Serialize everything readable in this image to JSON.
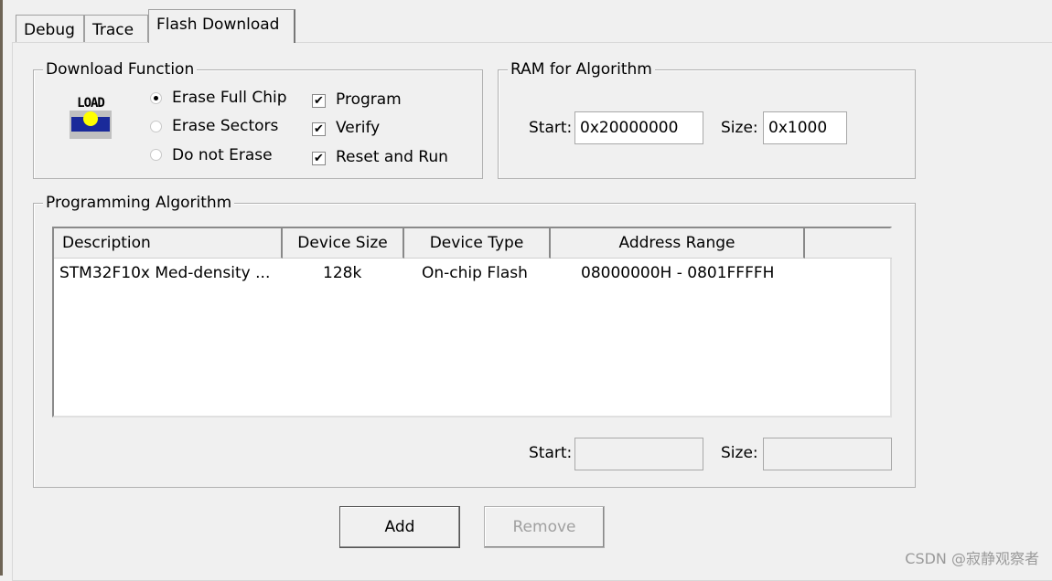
{
  "tabs": [
    {
      "label": "Debug"
    },
    {
      "label": "Trace"
    },
    {
      "label": "Flash Download",
      "active": true
    }
  ],
  "download_function": {
    "title": "Download Function",
    "icon": "load-icon",
    "icon_text": "LOAD",
    "radios": [
      {
        "label": "Erase Full Chip",
        "checked": true
      },
      {
        "label": "Erase Sectors",
        "checked": false
      },
      {
        "label": "Do not Erase",
        "checked": false
      }
    ],
    "checkboxes": [
      {
        "label": "Program",
        "checked": true
      },
      {
        "label": "Verify",
        "checked": true
      },
      {
        "label": "Reset and Run",
        "checked": true
      }
    ],
    "check_glyph": "✔"
  },
  "ram": {
    "title": "RAM for Algorithm",
    "start_label": "Start:",
    "start_value": "0x20000000",
    "size_label": "Size:",
    "size_value": "0x1000"
  },
  "algorithm": {
    "title": "Programming Algorithm",
    "columns": [
      "Description",
      "Device Size",
      "Device Type",
      "Address Range"
    ],
    "rows": [
      [
        "STM32F10x Med-density ...",
        "128k",
        "On-chip Flash",
        "08000000H - 0801FFFFH"
      ]
    ],
    "start_label": "Start:",
    "start_value": "",
    "size_label": "Size:",
    "size_value": ""
  },
  "buttons": {
    "add": "Add",
    "remove": "Remove"
  },
  "watermark": "CSDN @寂静观察者"
}
